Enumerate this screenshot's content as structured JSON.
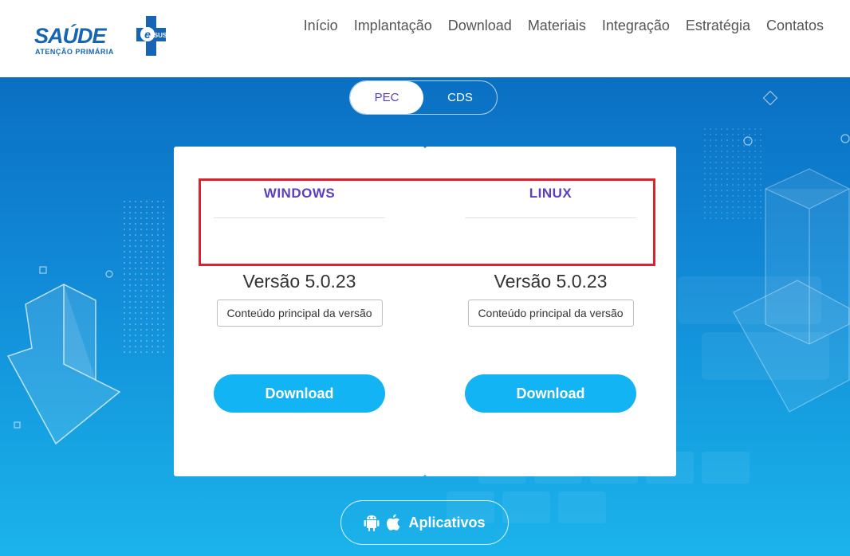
{
  "header": {
    "logo": {
      "word": "SAÚDE",
      "badge": "e SUS",
      "subtitle": "ATENÇÃO PRIMÁRIA"
    },
    "nav": [
      "Início",
      "Implantação",
      "Download",
      "Materiais",
      "Integração",
      "Estratégia",
      "Contatos"
    ]
  },
  "toggle": {
    "options": [
      "PEC",
      "CDS"
    ],
    "selected": "PEC"
  },
  "cards": [
    {
      "os": "WINDOWS",
      "version": "Versão 5.0.23",
      "notes_label": "Conteúdo principal da versão",
      "download_label": "Download"
    },
    {
      "os": "LINUX",
      "version": "Versão 5.0.23",
      "notes_label": "Conteúdo principal da versão",
      "download_label": "Download"
    }
  ],
  "apps_button": {
    "label": "Aplicativos",
    "icons": [
      "android-icon",
      "apple-icon"
    ]
  },
  "colors": {
    "brand_blue": "#1565b4",
    "accent_purple": "#5a3fc0",
    "download_cyan": "#13b4f3",
    "highlight_red": "#e0202a"
  }
}
